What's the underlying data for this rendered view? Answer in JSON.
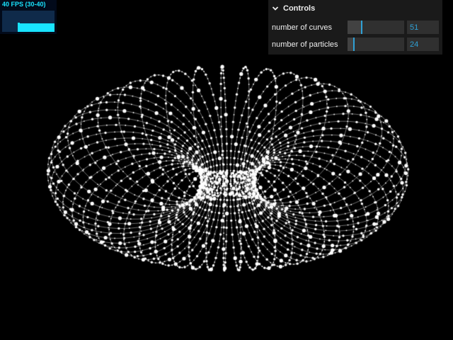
{
  "stats": {
    "fps_text": "40 FPS (30-40)",
    "bar_color": "#19e3ff"
  },
  "controls": {
    "title": "Controls",
    "accent": "#2fa1d6",
    "rows": [
      {
        "label": "number of curves",
        "value": "51",
        "slider_fraction": 0.25
      },
      {
        "label": "number of particles",
        "value": "24",
        "slider_fraction": 0.1
      }
    ]
  },
  "scene": {
    "description_shape": "torus",
    "curve_color": "#ffffff"
  }
}
